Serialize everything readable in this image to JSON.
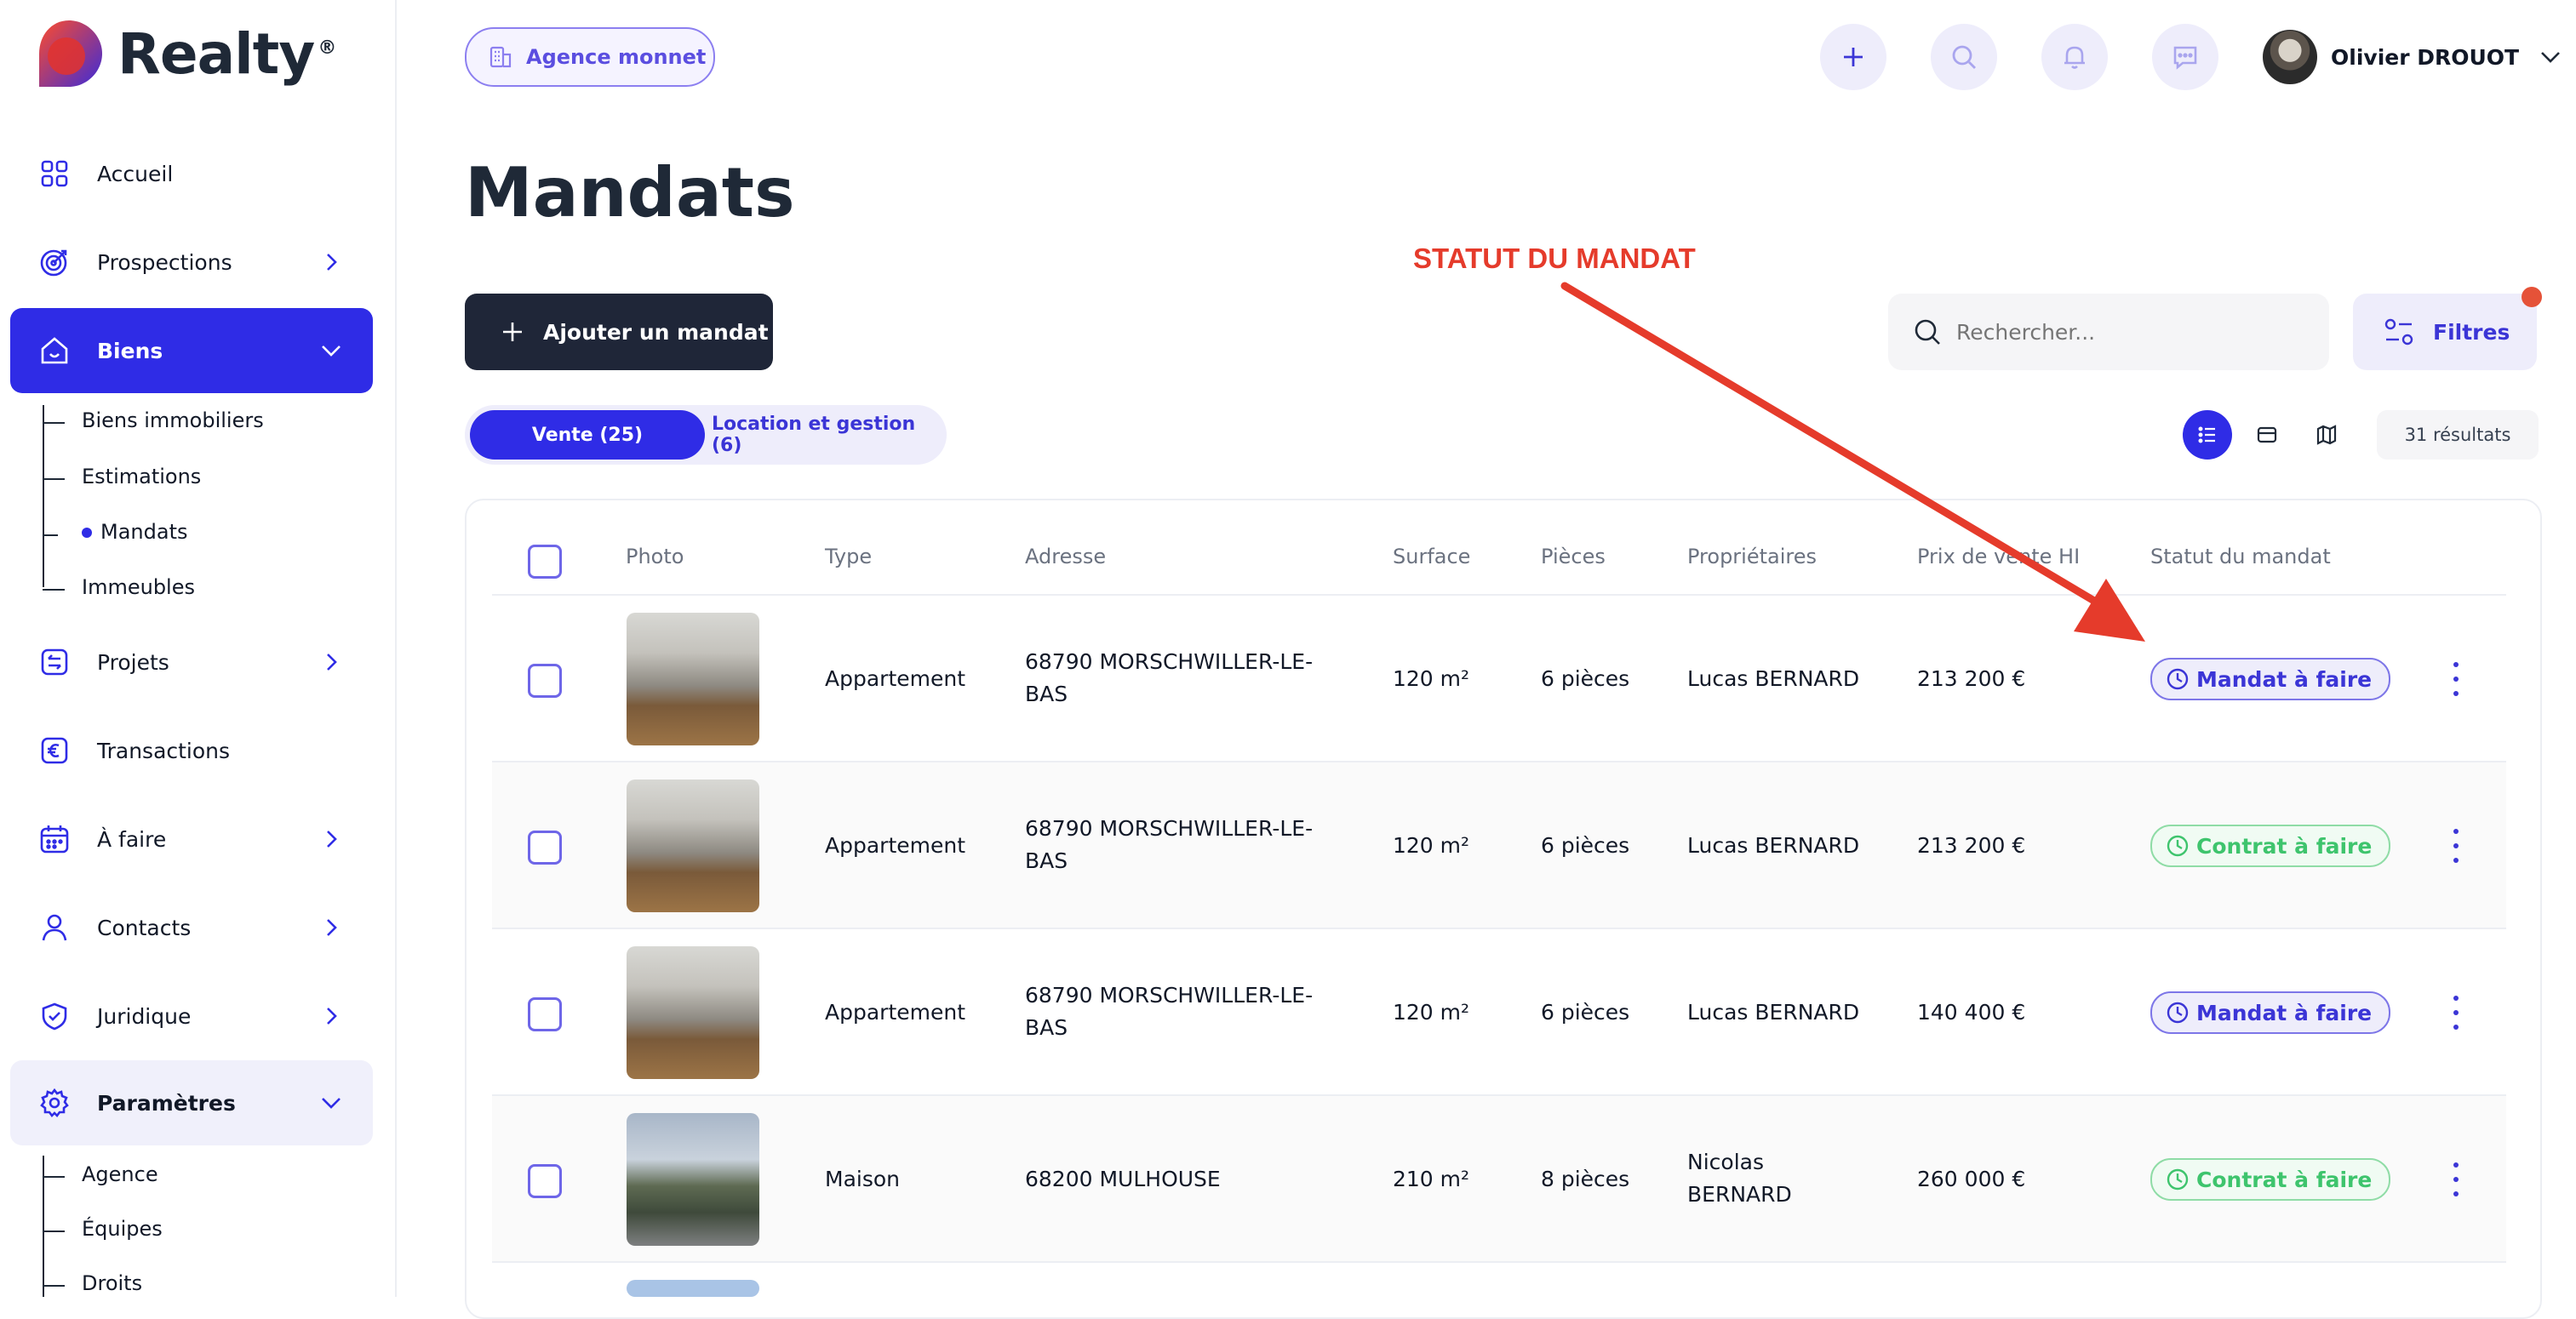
{
  "brand": {
    "name": "Realty",
    "reg": "®"
  },
  "sidebar": {
    "items": [
      {
        "label": "Accueil",
        "icon": "grid-icon"
      },
      {
        "label": "Prospections",
        "icon": "target-icon"
      },
      {
        "label": "Biens",
        "icon": "home-icon"
      },
      {
        "label": "Projets",
        "icon": "swap-icon"
      },
      {
        "label": "Transactions",
        "icon": "euro-icon"
      },
      {
        "label": "À faire",
        "icon": "calendar-icon"
      },
      {
        "label": "Contacts",
        "icon": "user-icon"
      },
      {
        "label": "Juridique",
        "icon": "shield-icon"
      },
      {
        "label": "Paramètres",
        "icon": "gear-icon"
      }
    ],
    "biens_sub": [
      "Biens immobiliers",
      "Estimations",
      "Mandats",
      "Immeubles"
    ],
    "params_sub": [
      "Agence",
      "Équipes",
      "Droits"
    ]
  },
  "topbar": {
    "agency": "Agence monnet",
    "user_name": "Olivier DROUOT"
  },
  "page": {
    "title": "Mandats",
    "annotation": "STATUT DU MANDAT",
    "add_button": "Ajouter un mandat",
    "search_placeholder": "Rechercher...",
    "filters": "Filtres",
    "tabs": [
      "Vente (25)",
      "Location et gestion (6)"
    ],
    "results": "31 résultats"
  },
  "table": {
    "headers": [
      "Photo",
      "Type",
      "Adresse",
      "Surface",
      "Pièces",
      "Propriétaires",
      "Prix de vente HI",
      "Statut du mandat"
    ],
    "rows": [
      {
        "type": "Appartement",
        "addr1": "68790 MORSCHWILLER-LE-",
        "addr2": "BAS",
        "surface": "120 m²",
        "pieces": "6 pièces",
        "owner1": "Lucas BERNARD",
        "owner2": "",
        "price": "213 200 €",
        "status": "Mandat à faire"
      },
      {
        "type": "Appartement",
        "addr1": "68790 MORSCHWILLER-LE-",
        "addr2": "BAS",
        "surface": "120 m²",
        "pieces": "6 pièces",
        "owner1": "Lucas BERNARD",
        "owner2": "",
        "price": "213 200 €",
        "status": "Contrat à faire"
      },
      {
        "type": "Appartement",
        "addr1": "68790 MORSCHWILLER-LE-",
        "addr2": "BAS",
        "surface": "120 m²",
        "pieces": "6 pièces",
        "owner1": "Lucas BERNARD",
        "owner2": "",
        "price": "140 400 €",
        "status": "Mandat à faire"
      },
      {
        "type": "Maison",
        "addr1": "68200 MULHOUSE",
        "addr2": "",
        "surface": "210 m²",
        "pieces": "8 pièces",
        "owner1": "Nicolas",
        "owner2": "BERNARD",
        "price": "260 000 €",
        "status": "Contrat à faire"
      }
    ]
  },
  "colors": {
    "primary": "#2f2ce6",
    "dark_button": "#1f2638",
    "annotation_red": "#e53b2b",
    "status_blue": "#3b35d6",
    "status_green": "#3ec46d"
  }
}
